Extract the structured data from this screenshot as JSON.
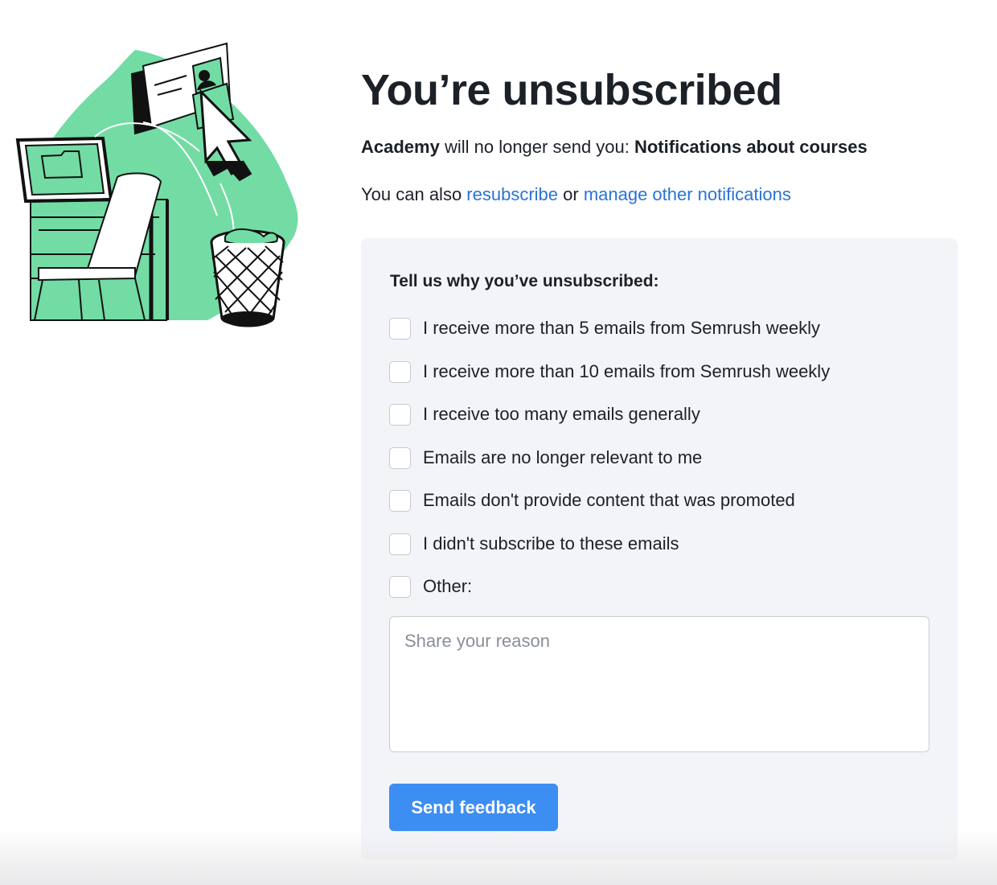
{
  "header": {
    "title": "You’re unsubscribed"
  },
  "summary": {
    "sender": "Academy",
    "middle_text": " will no longer send you: ",
    "topic": "Notifications about courses"
  },
  "alternatives": {
    "prefix": "You can also ",
    "resubscribe_label": "resubscribe",
    "joiner": " or ",
    "manage_label": "manage other notifications"
  },
  "feedback": {
    "heading": "Tell us why you’ve unsubscribed:",
    "options": [
      {
        "label": "I receive more than 5 emails from Semrush weekly",
        "checked": false
      },
      {
        "label": "I receive more than 10 emails from Semrush weekly",
        "checked": false
      },
      {
        "label": "I receive too many emails generally",
        "checked": false
      },
      {
        "label": "Emails are no longer relevant to me",
        "checked": false
      },
      {
        "label": "Emails don't provide content that was promoted",
        "checked": false
      },
      {
        "label": "I didn't subscribe to these emails",
        "checked": false
      },
      {
        "label": "Other:",
        "checked": false
      }
    ],
    "reason_placeholder": "Share your reason",
    "reason_value": "",
    "submit_label": "Send feedback"
  },
  "colors": {
    "link": "#2a73d6",
    "button": "#3c8ef3",
    "card_background": "#f3f4f8",
    "illustration_green": "#72dca4"
  }
}
